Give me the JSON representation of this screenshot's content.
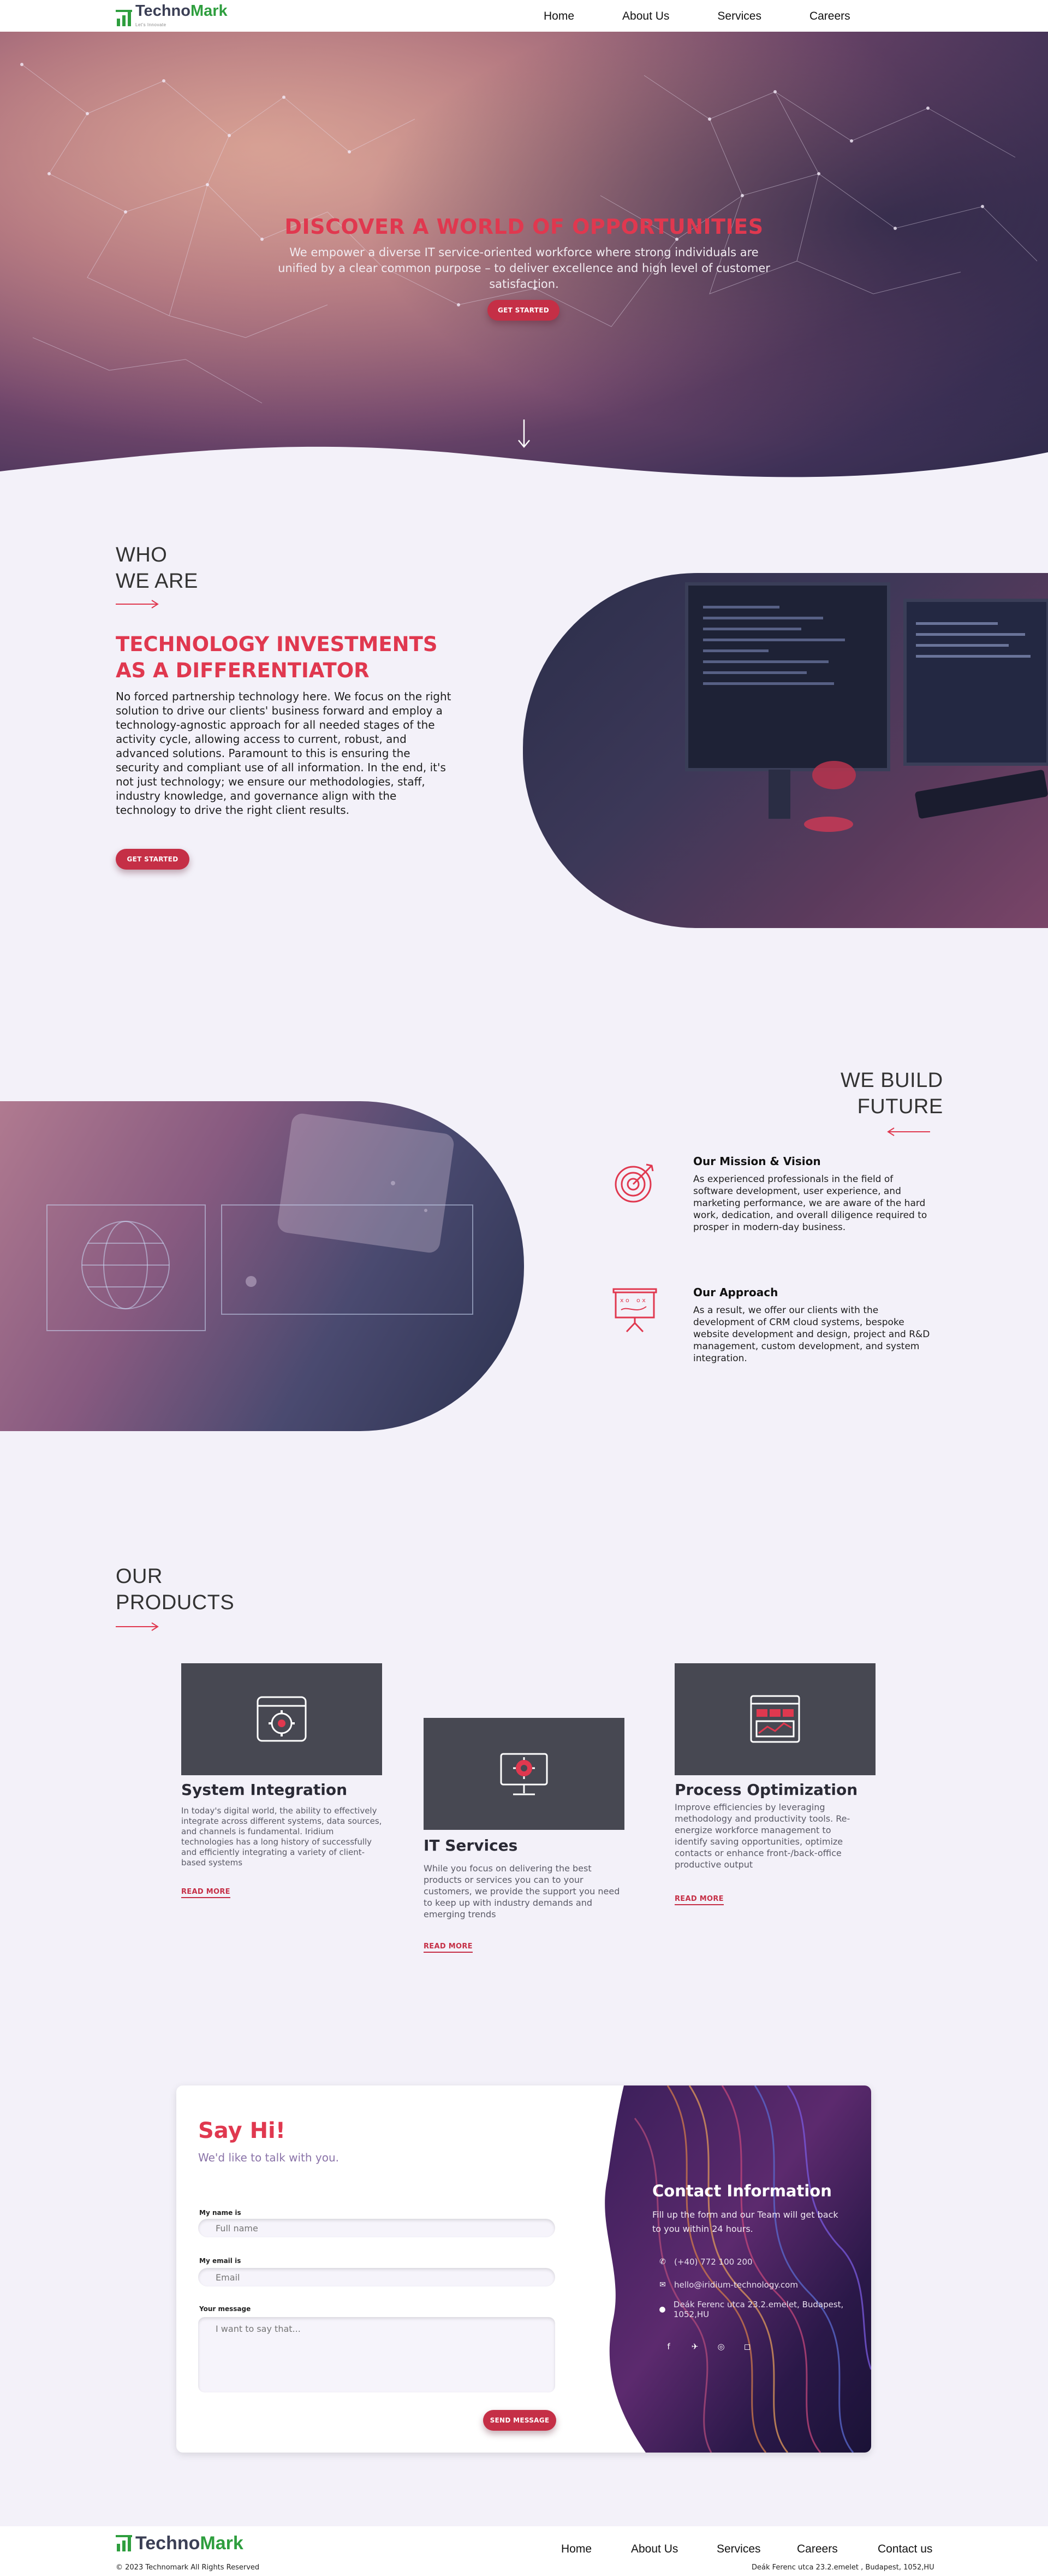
{
  "brand": {
    "name_part1": "Techno",
    "name_part2": "Mark",
    "tagline": "Let's Innovate",
    "green": "#2e9e3e",
    "accent": "#e0384f"
  },
  "nav": {
    "items": [
      "Home",
      "About Us",
      "Services",
      "Careers"
    ]
  },
  "hero": {
    "title": "DISCOVER A WORLD OF OPPORTUNITIES",
    "subtitle": "We empower a diverse IT service-oriented workforce where strong individuals are unified by a clear common purpose – to deliver excellence and high level of customer satisfaction.",
    "button": "GET STARTED",
    "scroll_icon": "arrow-down-icon"
  },
  "who": {
    "heading_line1": "WHO",
    "heading_line2": "WE ARE",
    "title": "TECHNOLOGY INVESTMENTS AS A DIFFERENTIATOR",
    "text": "No forced partnership technology here. We focus on the right solution to drive our clients' business forward and employ a technology-agnostic approach for all needed stages of the activity cycle, allowing access to current, robust, and advanced solutions. Paramount to this is ensuring the security and compliant use of all information. In the end, it's not just technology; we ensure our methodologies, staff, industry knowledge, and governance align with the technology to drive the right client results.",
    "button": "GET STARTED"
  },
  "build": {
    "heading_line1": "WE BUILD",
    "heading_line2": "FUTURE",
    "features": [
      {
        "title": "Our Mission & Vision",
        "text": "As experienced professionals in the field of software development, user experience, and marketing performance, we are aware of the hard work, dedication, and overall diligence required to prosper in modern-day business.",
        "icon": "target-icon"
      },
      {
        "title": "Our Approach",
        "text": "As a result, we offer our clients with the development of CRM cloud systems, bespoke website development and design, project and R&D management, custom development, and system integration.",
        "icon": "presentation-board-icon"
      }
    ]
  },
  "products": {
    "heading_line1": "OUR",
    "heading_line2": "PRODUCTS",
    "cards": [
      {
        "title": "System Integration",
        "text": "In today's digital world, the ability to effectively integrate across different systems, data sources, and channels is fundamental. Iridium technologies has a long history of successfully and efficiently integrating a variety of client-based systems",
        "link": "READ MORE",
        "icon": "gear-window-icon"
      },
      {
        "title": "IT Services",
        "text": "While you focus on delivering the best products or services you can to your customers, we provide the support you need to keep up with industry demands and emerging trends",
        "link": "READ MORE",
        "icon": "monitor-gear-icon"
      },
      {
        "title": "Process Optimization",
        "text": "Improve efficiencies by leveraging methodology and productivity tools. Re-energize workforce management to identify saving opportunities, optimize contacts or enhance front-/back-office productive output",
        "link": "READ MORE",
        "icon": "dashboard-window-icon"
      }
    ]
  },
  "contact": {
    "title": "Say Hi!",
    "subtitle": "We'd like to talk with you.",
    "name_label": "My name is",
    "name_placeholder": "Full name",
    "email_label": "My email is",
    "email_placeholder": "Email",
    "message_label": "Your message",
    "message_placeholder": "I want to say that...",
    "send": "SEND MESSAGE",
    "info_title": "Contact Information",
    "info_text": "Fill up the form and our Team will get back to you within 24 hours.",
    "phone": "(+40) 772 100 200",
    "email": "hello@iridium-technology.com",
    "address": "Deák Ferenc utca 23.2.emelet, Budapest, 1052,HU",
    "socials": [
      "facebook-icon",
      "twitter-icon",
      "dribbble-icon",
      "instagram-icon"
    ]
  },
  "footer": {
    "nav": [
      "Home",
      "About Us",
      "Services",
      "Careers",
      "Contact us"
    ],
    "copyright": "© 2023 Technomark All Rights Reserved",
    "address": "Deák Ferenc utca 23.2.emelet , Budapest, 1052,HU"
  }
}
